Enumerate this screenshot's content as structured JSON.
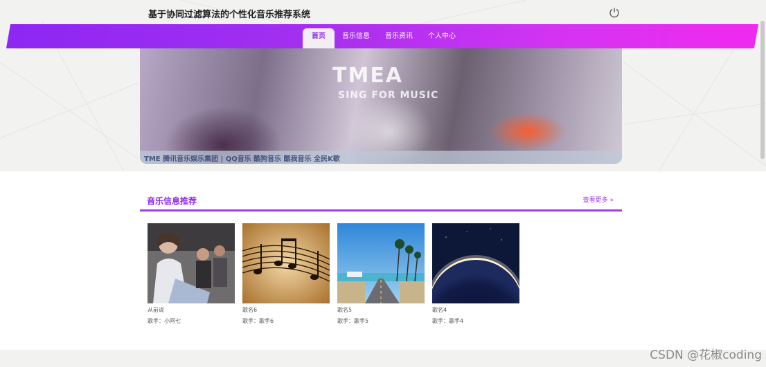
{
  "header": {
    "site_title": "基于协同过滤算法的个性化音乐推荐系统"
  },
  "nav": {
    "items": [
      {
        "label": "首页",
        "active": true
      },
      {
        "label": "音乐信息",
        "active": false
      },
      {
        "label": "音乐资讯",
        "active": false
      },
      {
        "label": "个人中心",
        "active": false
      }
    ]
  },
  "banner": {
    "logo_text": "TMEA",
    "sub_text": "SING FOR MUSIC",
    "strip_text": "TME 腾讯音乐娱乐集团 | QQ音乐 酷狗音乐 酷我音乐 全民K歌"
  },
  "section": {
    "title": "音乐信息推荐",
    "view_more": "查看更多 »"
  },
  "cards": [
    {
      "name": "从前说",
      "singer": "歌手：小阿七"
    },
    {
      "name": "歌名6",
      "singer": "歌手：歌手6"
    },
    {
      "name": "歌名5",
      "singer": "歌手：歌手5"
    },
    {
      "name": "歌名4",
      "singer": "歌手：歌手4"
    }
  ],
  "watermark": "CSDN @花椒coding",
  "colors": {
    "accent": "#8e2cf1",
    "nav_gradient_start": "#8d27f3",
    "nav_gradient_end": "#f029ef"
  }
}
